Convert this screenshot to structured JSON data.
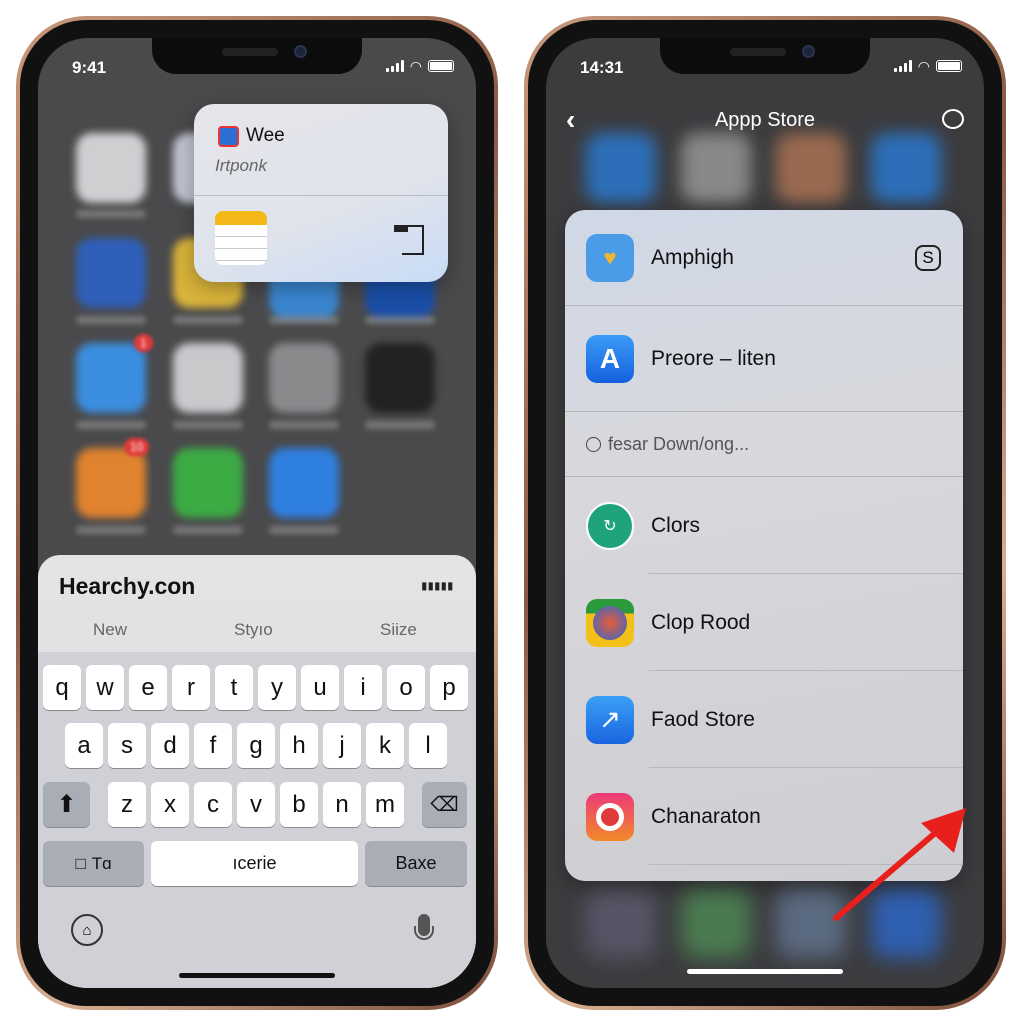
{
  "left_phone": {
    "status": {
      "time": "9:41"
    },
    "home_badges": [
      "1",
      "10"
    ],
    "popup": {
      "title": "Wee",
      "subtitle": "Irtponk",
      "app_icon": "messaging-app-icon",
      "note_icon": "notes-icon",
      "action_icon": "bracket-icon"
    },
    "keyboard": {
      "suggestion_title": "Hearchy.con",
      "more_icon": "dots-icon",
      "tabs": [
        "New",
        "Styıo",
        "Siize"
      ],
      "row1": [
        "q",
        "w",
        "e",
        "r",
        "t",
        "y",
        "u",
        "i",
        "o",
        "p"
      ],
      "row2": [
        "a",
        "s",
        "d",
        "f",
        "g",
        "h",
        "j",
        "k",
        "l"
      ],
      "row3": [
        "z",
        "x",
        "c",
        "v",
        "b",
        "n",
        "m"
      ],
      "shift_icon": "shift-icon",
      "delete_icon": "delete-icon",
      "mode_label": "Tɑ",
      "space_label": "ıcerie",
      "return_label": "Baxe",
      "home_icon": "home-icon",
      "mic_icon": "microphone-icon"
    }
  },
  "right_phone": {
    "status": {
      "time": "14:31"
    },
    "nav": {
      "title": "Appp Store",
      "back_icon": "chevron-left-icon",
      "action_icon": "apple-timer-icon"
    },
    "list": [
      {
        "name": "Amphigh",
        "trailing_icon": "hexagon-s-icon"
      },
      {
        "name": "Preore – liten"
      },
      {
        "name": "fesar Down/ong..."
      },
      {
        "name": "Clors"
      },
      {
        "name": "Clop Rood"
      },
      {
        "name": "Faod Store"
      },
      {
        "name": "Chanaraton"
      }
    ],
    "annotation_color": "#e8201c"
  }
}
